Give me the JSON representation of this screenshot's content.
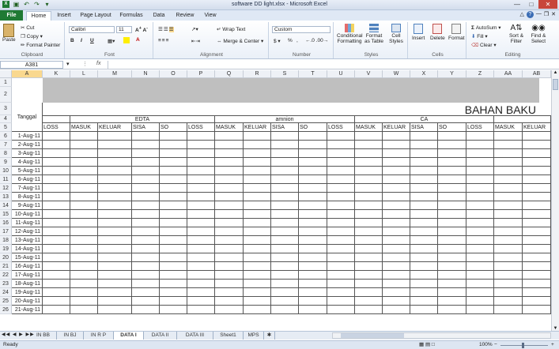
{
  "window": {
    "title": "software DD light.xlsx - Microsoft Excel"
  },
  "ribbon_tabs": [
    "Home",
    "Insert",
    "Page Layout",
    "Formulas",
    "Data",
    "Review",
    "View"
  ],
  "file_tab": "File",
  "clipboard": {
    "paste": "Paste",
    "cut": "Cut",
    "copy": "Copy",
    "format_painter": "Format Painter",
    "label": "Clipboard"
  },
  "font": {
    "name": "Calibri",
    "size": "11",
    "label": "Font"
  },
  "alignment": {
    "wrap": "Wrap Text",
    "merge": "Merge & Center",
    "label": "Alignment"
  },
  "number": {
    "format": "Custom",
    "label": "Number"
  },
  "styles": {
    "conditional": "Conditional Formatting",
    "table": "Format as Table",
    "cell": "Cell Styles",
    "label": "Styles"
  },
  "cells": {
    "insert": "Insert",
    "delete": "Delete",
    "format": "Format",
    "label": "Cells"
  },
  "editing": {
    "autosum": "AutoSum",
    "fill": "Fill",
    "clear": "Clear",
    "sort": "Sort & Filter",
    "find": "Find & Select",
    "label": "Editing"
  },
  "formula_bar": {
    "name_box": "A381",
    "fx": "fx",
    "content": ""
  },
  "columns": [
    "A",
    "K",
    "L",
    "M",
    "N",
    "O",
    "P",
    "Q",
    "R",
    "S",
    "T",
    "U",
    "V",
    "W",
    "X",
    "Y",
    "Z",
    "AA",
    "AB"
  ],
  "rows": [
    1,
    2,
    3,
    4,
    5,
    6,
    7,
    8,
    9,
    10,
    11,
    12,
    13,
    14,
    15,
    16,
    17,
    18,
    19,
    20,
    21,
    22,
    23,
    24,
    25,
    26
  ],
  "sheet": {
    "title": "BAHAN BAKU",
    "tanggal": "Tanggal",
    "groups": [
      "EDTA",
      "amnion",
      "CA"
    ],
    "subheaders": [
      "LOSS",
      "MASUK",
      "KELUAR",
      "SISA",
      "SO",
      "LOSS",
      "MASUK",
      "KELUAR",
      "SISA",
      "SO",
      "LOSS",
      "MASUK",
      "KELUAR",
      "SISA",
      "SO",
      "LOSS",
      "MASUK",
      "KELUAR"
    ],
    "dates": [
      "1-Aug-11",
      "2-Aug-11",
      "3-Aug-11",
      "4-Aug-11",
      "5-Aug-11",
      "6-Aug-11",
      "7-Aug-11",
      "8-Aug-11",
      "9-Aug-11",
      "10-Aug-11",
      "11-Aug-11",
      "12-Aug-11",
      "13-Aug-11",
      "14-Aug-11",
      "15-Aug-11",
      "16-Aug-11",
      "17-Aug-11",
      "18-Aug-11",
      "19-Aug-11",
      "20-Aug-11",
      "21-Aug-11"
    ]
  },
  "sheet_tabs": [
    "IN BB",
    "IN BJ",
    "IN R P",
    "DATA I",
    "DATA II",
    "DATA III",
    "Sheet1",
    "MPS"
  ],
  "active_sheet": "DATA I",
  "status": {
    "ready": "Ready",
    "zoom": "100%"
  },
  "colors": {
    "file_tab": "#1f7a34",
    "header_band": "#bfbfbf",
    "selected_col": "#f9d88f"
  }
}
